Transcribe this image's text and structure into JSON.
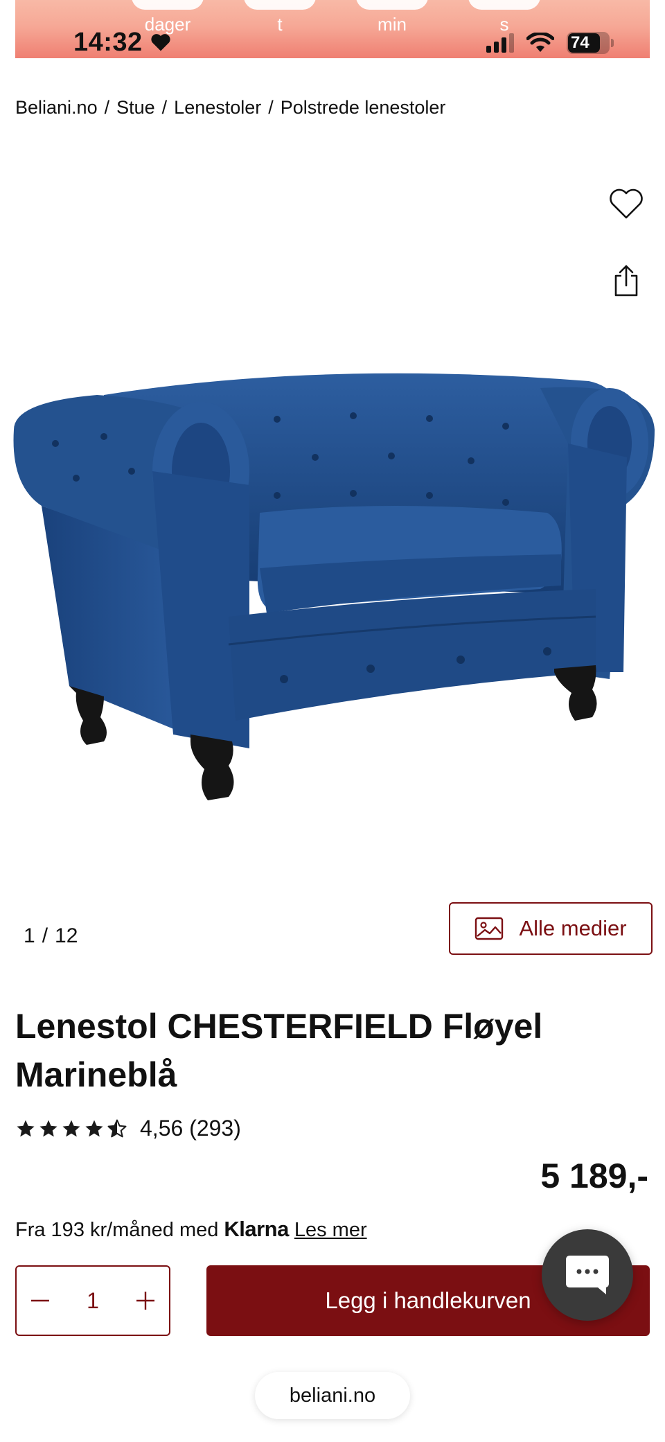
{
  "status_bar": {
    "countdown_labels": [
      "dager",
      "t",
      "min",
      "s"
    ],
    "time": "14:32",
    "battery": "74"
  },
  "breadcrumb": [
    "Beliani.no",
    "Stue",
    "Lenestoler",
    "Polstrede lenestoler"
  ],
  "breadcrumb_separator": "/",
  "gallery": {
    "current": "1",
    "separator": "/",
    "total": "12",
    "all_media_label": "Alle medier"
  },
  "product": {
    "title": "Lenestol CHESTERFIELD Fløyel Marineblå",
    "rating_value": 4.56,
    "rating_text": "4,56 (293)",
    "price": "5 189,-",
    "financing": {
      "prefix": "Fra 193 kr/måned med",
      "provider": "Klarna",
      "link": "Les mer"
    }
  },
  "cart": {
    "quantity": "1",
    "add_label": "Legg i handlekurven"
  },
  "url": "beliani.no",
  "colors": {
    "accent": "#7b0f12",
    "banner_top": "#f8b9a6",
    "banner_bottom": "#ef7f72",
    "chair_blue": "#1f4a86",
    "chat_bubble": "#3a3a3a"
  },
  "icons": [
    "heart-icon",
    "share-icon",
    "image-icon",
    "minus-icon",
    "plus-icon",
    "chat-icon",
    "star-icon",
    "signal-icon",
    "wifi-icon",
    "battery-icon"
  ]
}
